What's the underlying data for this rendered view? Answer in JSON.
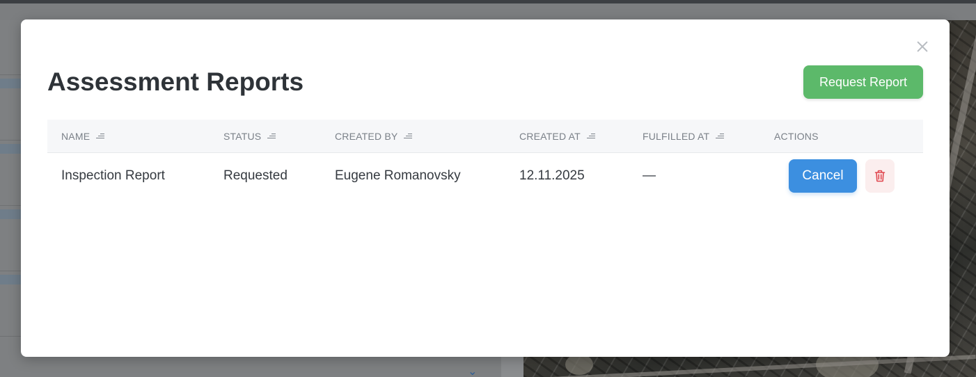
{
  "modal": {
    "title": "Assessment Reports",
    "request_button": "Request Report",
    "close_icon": "close-icon"
  },
  "table": {
    "columns": [
      {
        "label": "NAME",
        "sortable": true
      },
      {
        "label": "STATUS",
        "sortable": true
      },
      {
        "label": "CREATED BY",
        "sortable": true
      },
      {
        "label": "CREATED AT",
        "sortable": true
      },
      {
        "label": "FULFILLED AT",
        "sortable": true
      },
      {
        "label": "ACTIONS",
        "sortable": false
      }
    ],
    "rows": [
      {
        "name": "Inspection Report",
        "status": "Requested",
        "created_by": "Eugene Romanovsky",
        "created_at": "12.11.2025",
        "fulfilled_at": "—",
        "cancel_label": "Cancel",
        "delete_icon": "trash-icon"
      }
    ]
  },
  "colors": {
    "primary_green": "#5cb96a",
    "primary_blue": "#3c8fe0",
    "danger_red": "#e0464e",
    "title_text": "#2e3338"
  }
}
